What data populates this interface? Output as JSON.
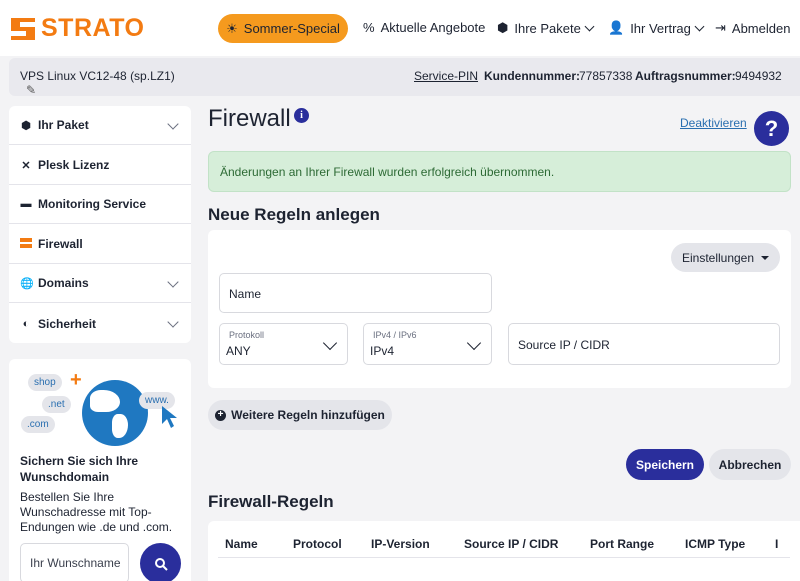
{
  "brand": {
    "name": "STRATO",
    "color": "#f37b12"
  },
  "header": {
    "promo_button": "Sommer-Special",
    "nav": [
      {
        "label": "Aktuelle Angebote",
        "icon": "percent-icon"
      },
      {
        "label": "Ihre Pakete",
        "icon": "box-icon"
      },
      {
        "label": "Ihr Vertrag",
        "icon": "user-icon"
      },
      {
        "label": "Abmelden",
        "icon": "logout-icon"
      }
    ]
  },
  "contract": {
    "product": "VPS Linux VC12-48 (sp.LZ1)",
    "service_pin": "Service-PIN",
    "customer_label": "Kundennummer:",
    "customer_number": "77857338",
    "order_label": "Auftragsnummer:",
    "order_number": "9494932"
  },
  "sidebar": {
    "items": [
      {
        "label": "Ihr Paket",
        "icon": "box-icon",
        "expandable": true
      },
      {
        "label": "Plesk Lizenz",
        "icon": "tools-icon",
        "expandable": false
      },
      {
        "label": "Monitoring Service",
        "icon": "monitor-icon",
        "expandable": false
      },
      {
        "label": "Firewall",
        "icon": "firewall-icon",
        "expandable": false
      },
      {
        "label": "Domains",
        "icon": "globe-icon",
        "expandable": true
      },
      {
        "label": "Sicherheit",
        "icon": "shield-icon",
        "expandable": true
      }
    ]
  },
  "promo": {
    "tags": [
      "shop",
      ".net",
      ".com",
      "www."
    ],
    "title": "Sichern Sie sich Ihre Wunschdomain",
    "text": "Bestellen Sie Ihre Wunschadresse mit Top-Endungen wie .de und .com.",
    "input_placeholder": "Ihr Wunschname"
  },
  "main": {
    "title": "Firewall",
    "deactivate_link": "Deaktivieren",
    "alert": "Änderungen an Ihrer Firewall wurden erfolgreich übernommen.",
    "new_rules": {
      "heading": "Neue Regeln anlegen",
      "settings_button": "Einstellungen",
      "name_placeholder": "Name",
      "protocol_label": "Protokoll",
      "protocol_value": "ANY",
      "ipversion_label": "IPv4 / IPv6",
      "ipversion_value": "IPv4",
      "source_placeholder": "Source IP / CIDR",
      "add_more_button": "Weitere Regeln hinzufügen"
    },
    "save_button": "Speichern",
    "cancel_button": "Abbrechen",
    "rules_table": {
      "heading": "Firewall-Regeln",
      "columns": [
        "Name",
        "Protocol",
        "IP-Version",
        "Source IP / CIDR",
        "Port Range",
        "ICMP Type",
        "I"
      ]
    }
  },
  "colors": {
    "primary": "#2a2e9c",
    "accent_orange": "#f59a1e",
    "success_bg": "#d6eed9",
    "success_text": "#2d6a35",
    "link": "#2a6fb0"
  }
}
